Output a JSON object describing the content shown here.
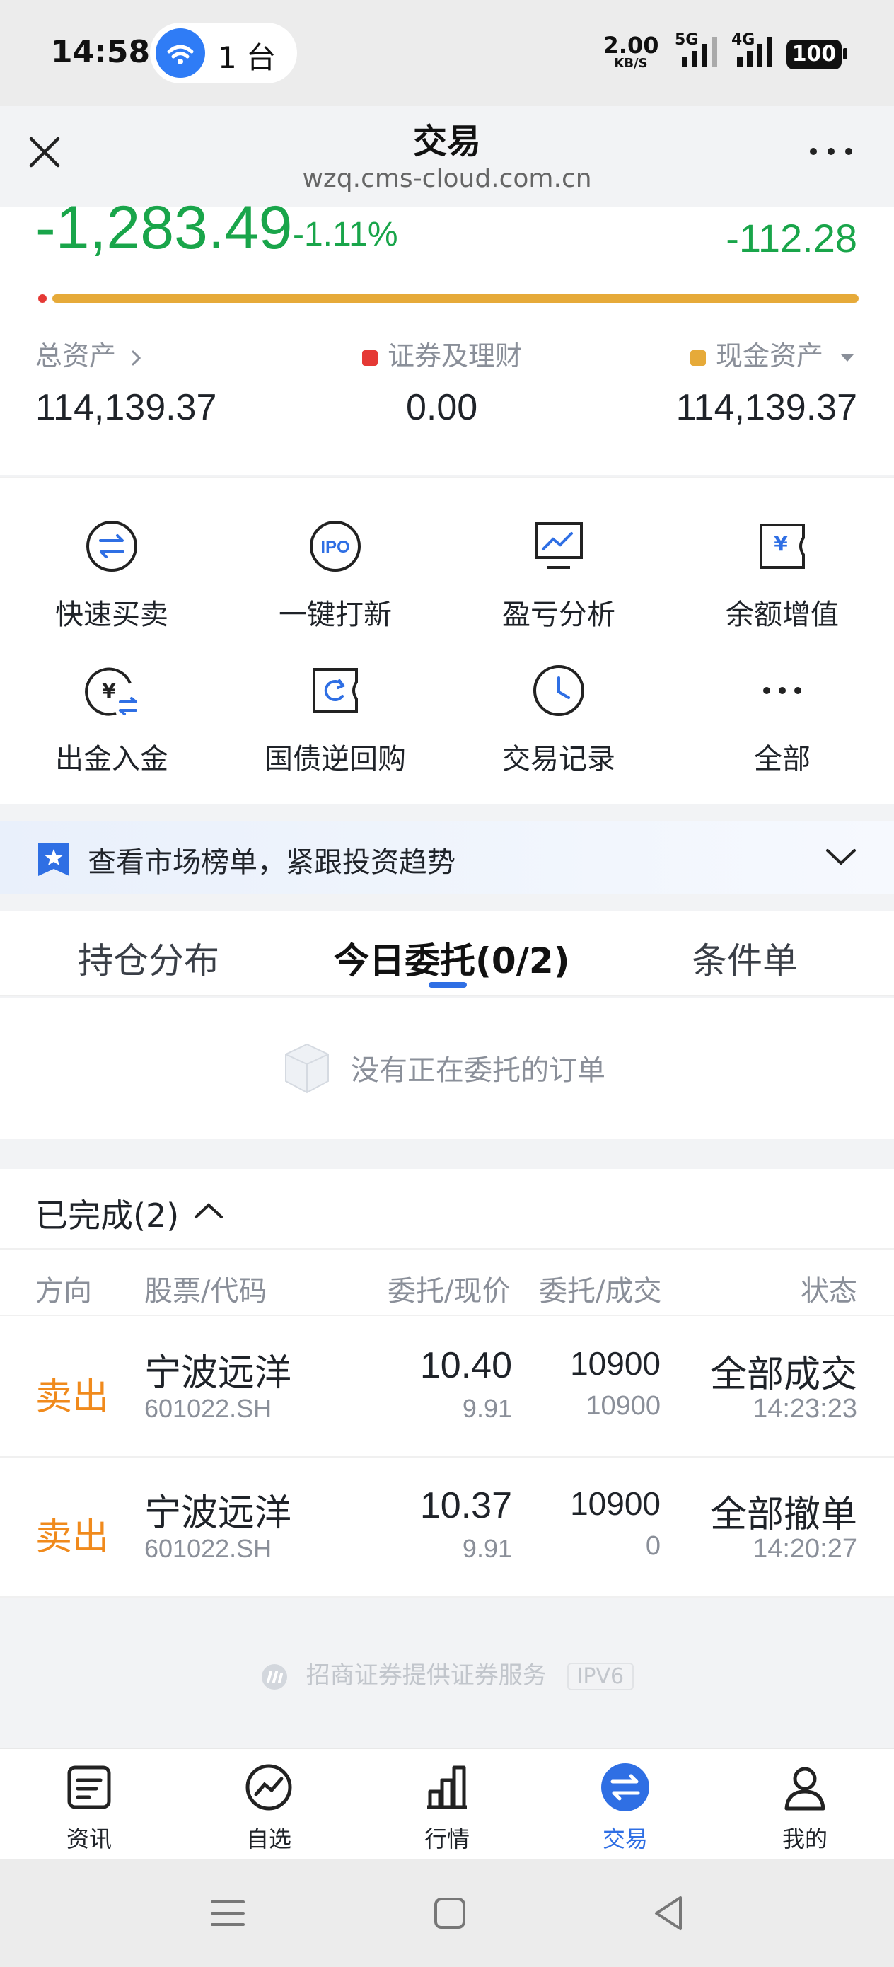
{
  "status_bar": {
    "time": "14:58",
    "hotspot_count": "1 台",
    "speed_value": "2.00",
    "speed_unit": "KB/S",
    "net1": "5G",
    "net2": "4G",
    "battery": "100"
  },
  "title_bar": {
    "title": "交易",
    "subtitle": "wzq.cms-cloud.com.cn"
  },
  "summary": {
    "pl_value": "-1,283.49",
    "pl_percent": "-1.11%",
    "today_pl": "-112.28",
    "total_assets_label": "总资产",
    "total_assets_value": "114,139.37",
    "securities_label": "证券及理财",
    "securities_value": "0.00",
    "cash_label": "现金资产",
    "cash_value": "114,139.37",
    "colors": {
      "securities": "#e53935",
      "cash": "#e6aa39",
      "negative": "#19a54a"
    }
  },
  "menu": {
    "items": [
      {
        "label": "快速买卖",
        "icon": "swap-circle-icon"
      },
      {
        "label": "一键打新",
        "icon": "ipo-icon"
      },
      {
        "label": "盈亏分析",
        "icon": "chart-monitor-icon"
      },
      {
        "label": "余额增值",
        "icon": "yen-ticket-icon"
      },
      {
        "label": "出金入金",
        "icon": "yen-transfer-icon"
      },
      {
        "label": "国债逆回购",
        "icon": "refresh-ticket-icon"
      },
      {
        "label": "交易记录",
        "icon": "clock-icon"
      },
      {
        "label": "全部",
        "icon": "more-dots-icon"
      }
    ]
  },
  "banner": {
    "text": "查看市场榜单，紧跟投资趋势"
  },
  "tabs": {
    "items": [
      "持仓分布",
      "今日委托(0/2)",
      "条件单"
    ],
    "active": "今日委托(0/2)"
  },
  "pending": {
    "empty_text": "没有正在委托的订单"
  },
  "completed": {
    "header": "已完成(2)",
    "columns": [
      "方向",
      "股票/代码",
      "委托/现价",
      "委托/成交",
      "状态"
    ],
    "rows": [
      {
        "direction": "卖出",
        "name": "宁波远洋",
        "code": "601022.SH",
        "order_price": "10.40",
        "current_price": "9.91",
        "order_qty": "10900",
        "deal_qty": "10900",
        "status": "全部成交",
        "time": "14:23:23"
      },
      {
        "direction": "卖出",
        "name": "宁波远洋",
        "code": "601022.SH",
        "order_price": "10.37",
        "current_price": "9.91",
        "order_qty": "10900",
        "deal_qty": "0",
        "status": "全部撤单",
        "time": "14:20:27"
      }
    ]
  },
  "footer": {
    "provider": "招商证券提供证券服务",
    "ipv6": "IPV6"
  },
  "bottom_nav": {
    "items": [
      "资讯",
      "自选",
      "行情",
      "交易",
      "我的"
    ],
    "active": "交易",
    "accent": "#2f6fe4"
  }
}
